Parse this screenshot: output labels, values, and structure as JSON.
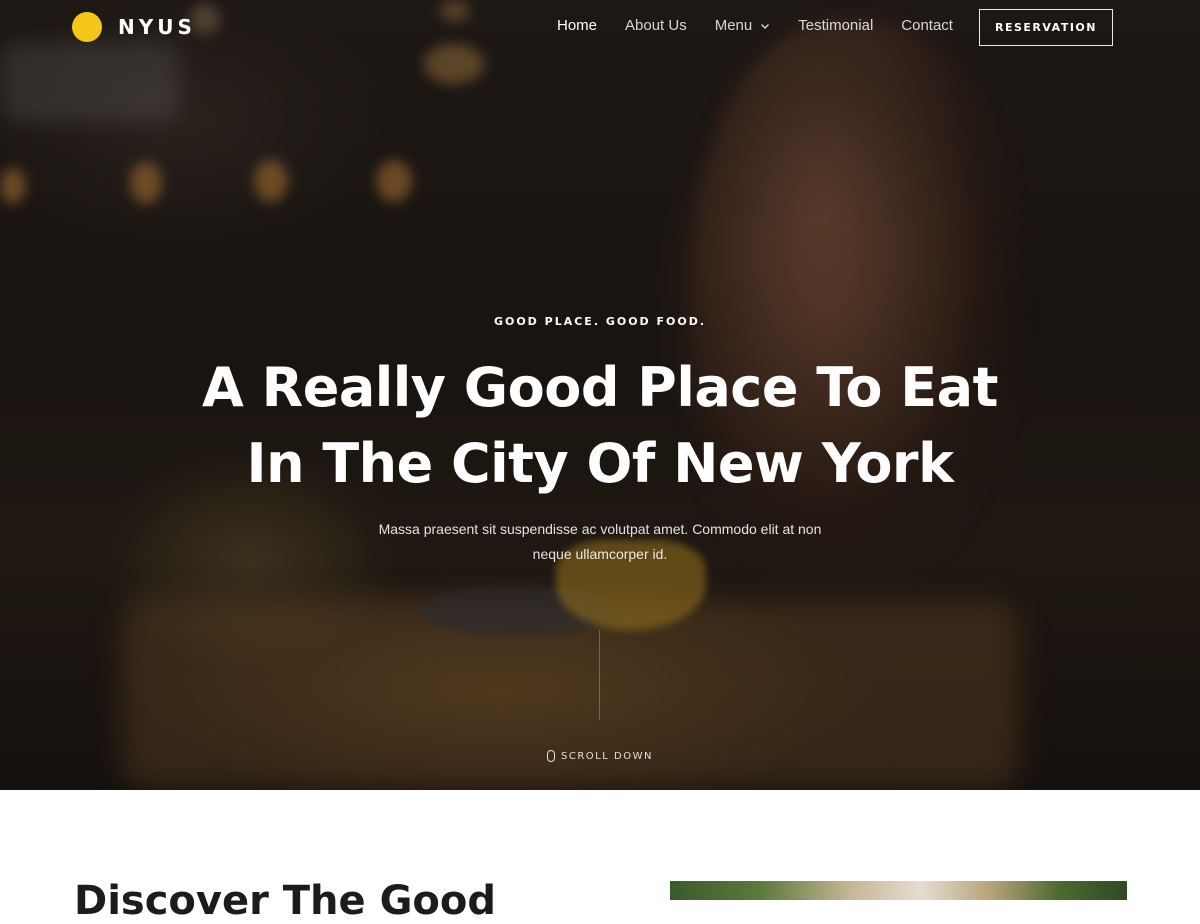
{
  "brand": {
    "name": "NYUS",
    "accent_color": "#f5c518"
  },
  "nav": {
    "items": [
      {
        "label": "Home",
        "active": true
      },
      {
        "label": "About Us",
        "active": false
      },
      {
        "label": "Menu",
        "active": false,
        "has_dropdown": true
      },
      {
        "label": "Testimonial",
        "active": false
      },
      {
        "label": "Contact",
        "active": false
      }
    ],
    "cta_label": "RESERVATION"
  },
  "hero": {
    "kicker": "GOOD PLACE. GOOD FOOD.",
    "headline_line1": "A Really Good Place To Eat",
    "headline_line2": "In The City Of New York",
    "subtext": "Massa praesent sit suspendisse ac volutpat amet. Commodo elit at non neque ullamcorper id.",
    "scroll_label": "SCROLL DOWN",
    "scroll_icon": "mouse-icon"
  },
  "section": {
    "heading": "Discover The Good"
  }
}
